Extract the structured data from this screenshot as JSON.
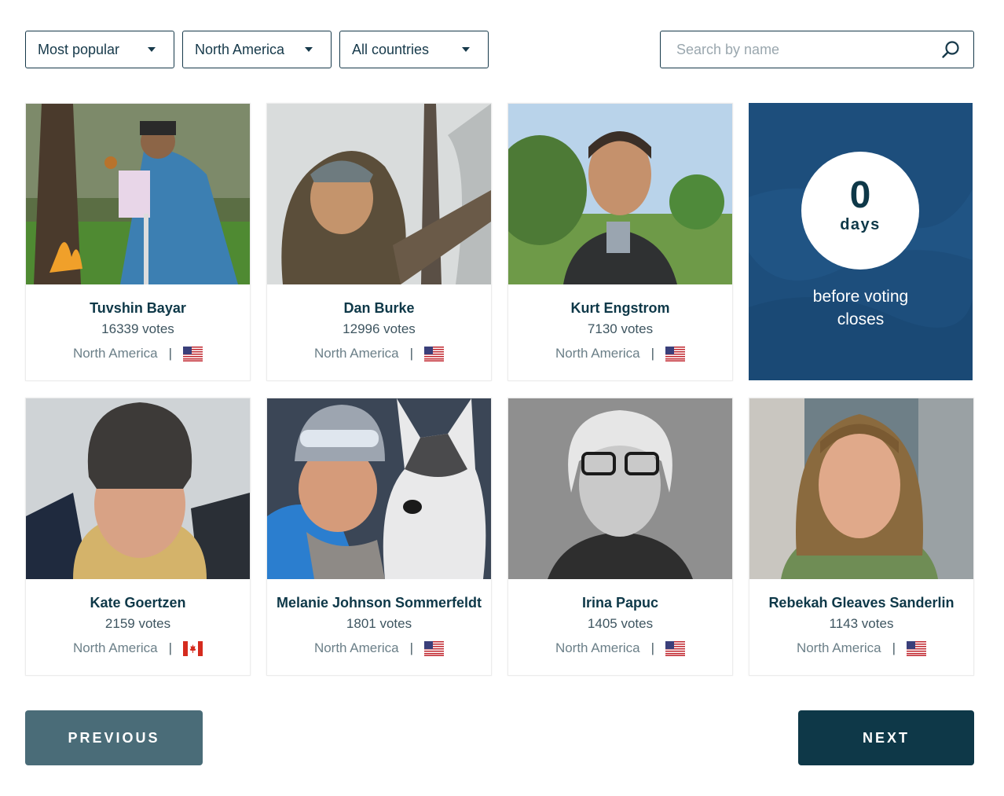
{
  "filters": {
    "sort": "Most popular",
    "region": "North America",
    "country": "All countries",
    "search_placeholder": "Search by name"
  },
  "countdown": {
    "number": "0",
    "unit": "days",
    "line1": "before voting",
    "line2": "closes"
  },
  "candidates": [
    {
      "name": "Tuvshin Bayar",
      "votes": "16339 votes",
      "region": "North America",
      "flag": "us-flag-icon"
    },
    {
      "name": "Dan Burke",
      "votes": "12996 votes",
      "region": "North America",
      "flag": "us-flag-icon"
    },
    {
      "name": "Kurt Engstrom",
      "votes": "7130 votes",
      "region": "North America",
      "flag": "us-flag-icon"
    },
    {
      "name": "Kate Goertzen",
      "votes": "2159 votes",
      "region": "North America",
      "flag": "canada-flag-icon"
    },
    {
      "name": "Melanie Johnson Sommerfeldt",
      "votes": "1801 votes",
      "region": "North America",
      "flag": "us-flag-icon"
    },
    {
      "name": "Irina Papuc",
      "votes": "1405 votes",
      "region": "North America",
      "flag": "us-flag-icon"
    },
    {
      "name": "Rebekah Gleaves Sanderlin",
      "votes": "1143 votes",
      "region": "North America",
      "flag": "us-flag-icon"
    }
  ],
  "separator": "|",
  "pagination": {
    "previous": "PREVIOUS",
    "next": "NEXT"
  },
  "colors": {
    "primary_dark": "#0e3848",
    "button_muted": "#4a6c78",
    "countdown_bg": "#1d4e7c"
  }
}
